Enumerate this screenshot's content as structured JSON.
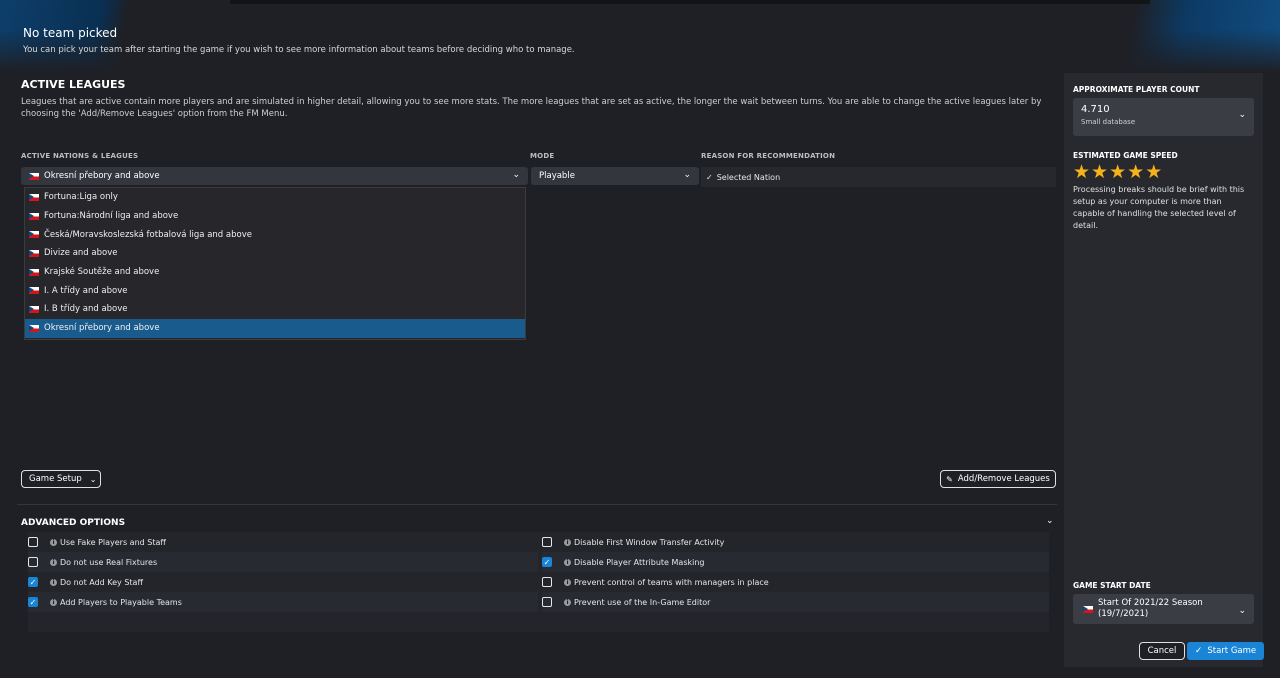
{
  "header": {
    "title": "No team picked",
    "subtitle": "You can pick your team after starting the game if you wish to see more information about teams before deciding who to manage."
  },
  "active_leagues": {
    "title": "ACTIVE LEAGUES",
    "description": "Leagues that are active contain more players and are simulated in higher detail, allowing you to see more stats. The more leagues that are set as active, the longer the wait between turns. You are able to change the active leagues later by choosing the 'Add/Remove Leagues' option from the FM Menu.",
    "col_nations": "ACTIVE NATIONS & LEAGUES",
    "col_mode": "MODE",
    "col_reason": "REASON FOR RECOMMENDATION",
    "selected_league": "Okresní přebory and above",
    "mode_value": "Playable",
    "reason": "Selected Nation",
    "league_options": [
      "Fortuna:Liga only",
      "Fortuna:Národní liga and above",
      "Česká/Moravskoslezská fotbalová liga and above",
      "Divize and above",
      "Krajské Soutěže and above",
      "I. A třídy and above",
      "I. B třídy and above",
      "Okresní přebory and above"
    ],
    "selected_index": 7
  },
  "buttons": {
    "game_setup": "Game Setup",
    "add_remove": "Add/Remove Leagues",
    "cancel": "Cancel",
    "start": "Start Game"
  },
  "advanced": {
    "title": "ADVANCED OPTIONS",
    "left": [
      {
        "label": "Use Fake Players and Staff",
        "checked": false
      },
      {
        "label": "Do not use Real Fixtures",
        "checked": false
      },
      {
        "label": "Do not Add Key Staff",
        "checked": true
      },
      {
        "label": "Add Players to Playable Teams",
        "checked": true
      }
    ],
    "right": [
      {
        "label": "Disable First Window Transfer Activity",
        "checked": false
      },
      {
        "label": "Disable Player Attribute Masking",
        "checked": true
      },
      {
        "label": "Prevent control of teams with managers in place",
        "checked": false
      },
      {
        "label": "Prevent use of the In-Game Editor",
        "checked": false
      }
    ]
  },
  "sidebar": {
    "player_count_title": "APPROXIMATE PLAYER COUNT",
    "player_count_value": "4.710",
    "player_count_sub": "Small database",
    "speed_title": "ESTIMATED GAME SPEED",
    "speed_stars": 5,
    "speed_desc": "Processing breaks should be brief with this setup as your computer is more than capable of handling the selected level of detail.",
    "start_date_title": "GAME START DATE",
    "start_date_value": "Start Of 2021/22 Season (19/7/2021)"
  },
  "icons": {
    "flag": "czech-flag-icon",
    "chevron": "chevron-down-icon",
    "info": "info-icon",
    "star": "star-icon",
    "pencil": "pencil-icon",
    "check": "check-icon"
  },
  "colors": {
    "accent": "#1a84d6",
    "selected_row": "#1a5b8e",
    "star": "#f5b21a"
  }
}
